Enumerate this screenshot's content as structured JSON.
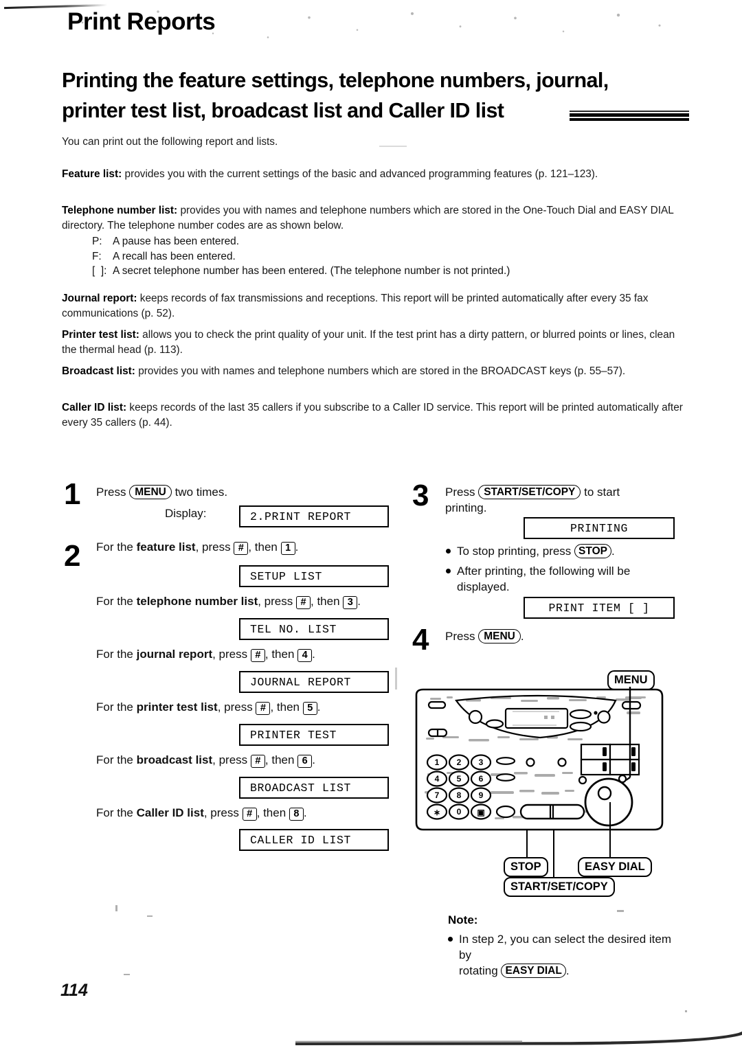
{
  "header": {
    "chapter_title": "Print Reports"
  },
  "heading": {
    "line1": "Printing the feature settings, telephone numbers, journal,",
    "line2": "printer test list, broadcast list and Caller ID list"
  },
  "intro": "You can print out the following report and lists.",
  "paragraphs": [
    {
      "id": "feature",
      "term": "Feature list:",
      "text": " provides you with the current settings of the basic and advanced programming features (p. 121–123)."
    },
    {
      "id": "telephone",
      "term": "Telephone number list:",
      "text": " provides you with names and telephone numbers which are stored in the One-Touch Dial and EASY DIAL directory. The telephone number codes are as shown below."
    },
    {
      "id": "journal",
      "term": "Journal report:",
      "text": " keeps records of fax transmissions and receptions. This report will be printed automatically after every 35 fax communications (p. 52)."
    },
    {
      "id": "printer",
      "term": "Printer test list:",
      "text": " allows you to check the print quality of your unit. If the test print has a dirty pattern, or blurred points or lines, clean the thermal head (p. 113)."
    },
    {
      "id": "broadcast",
      "term": "Broadcast list:",
      "text": " provides you with names and telephone numbers which are stored in the BROADCAST keys (p. 55–57)."
    },
    {
      "id": "callerid",
      "term": "Caller ID list:",
      "text": " keeps records of the last 35 callers if you subscribe to a Caller ID service. This report will be printed automatically after every 35 callers (p. 44)."
    }
  ],
  "code_list": [
    {
      "key": "P:",
      "desc": "A pause has been entered."
    },
    {
      "key": "F:",
      "desc": "A recall has been entered."
    },
    {
      "key": "[  ]:",
      "desc": "A secret telephone number has been entered. (The telephone number is not printed.)"
    }
  ],
  "steps": {
    "step1": {
      "number": "1",
      "text_before": "Press",
      "key": "MENU",
      "text_after": "two times.",
      "display_label": "Display:",
      "lcd": "2.PRINT REPORT"
    },
    "step2": {
      "number": "2",
      "items": [
        {
          "prefix": "For the",
          "term": "feature list",
          "mid": ", press",
          "key1": "#",
          "then": ", then",
          "key2": "1",
          "end": ".",
          "lcd": "SETUP LIST"
        },
        {
          "prefix": "For the",
          "term": "telephone number list",
          "mid": ", press",
          "key1": "#",
          "then": ", then",
          "key2": "3",
          "end": ".",
          "lcd": "TEL NO. LIST"
        },
        {
          "prefix": "For the",
          "term": "journal report",
          "mid": ", press",
          "key1": "#",
          "then": ", then",
          "key2": "4",
          "end": ".",
          "lcd": "JOURNAL REPORT"
        },
        {
          "prefix": "For the",
          "term": "printer test list",
          "mid": ", press",
          "key1": "#",
          "then": ", then",
          "key2": "5",
          "end": ".",
          "lcd": "PRINTER TEST"
        },
        {
          "prefix": "For the",
          "term": "broadcast list",
          "mid": ", press",
          "key1": "#",
          "then": ", then",
          "key2": "6",
          "end": ".",
          "lcd": "BROADCAST LIST"
        },
        {
          "prefix": "For the",
          "term": "Caller ID list",
          "mid": ", press",
          "key1": "#",
          "then": ", then",
          "key2": "8",
          "end": ".",
          "lcd": "CALLER ID LIST"
        }
      ]
    },
    "step3": {
      "number": "3",
      "text_before": "Press",
      "key": "START/SET/COPY",
      "text_after": "to start",
      "text_line2": "printing.",
      "lcd_printing": "PRINTING",
      "bullet1_before": "To stop printing, press",
      "bullet1_key": "STOP",
      "bullet1_after": ".",
      "bullet2_line1": "After printing, the following will be",
      "bullet2_line2": "displayed.",
      "lcd_print_item": "PRINT ITEM [  ]"
    },
    "step4": {
      "number": "4",
      "text_before": "Press",
      "key": "MENU",
      "text_after": "."
    }
  },
  "device_figure": {
    "callouts": {
      "menu": "MENU",
      "stop": "STOP",
      "easy_dial": "EASY DIAL",
      "start_set_copy": "START/SET/COPY"
    },
    "keypad": [
      "1",
      "2",
      "3",
      "4",
      "5",
      "6",
      "7",
      "8",
      "9",
      "∗",
      "0",
      "▣"
    ]
  },
  "note": {
    "title": "Note:",
    "line1": "In step 2, you can select the desired item by",
    "line2_before": "rotating",
    "line2_key": "EASY DIAL",
    "line2_after": "."
  },
  "page_number": "114"
}
